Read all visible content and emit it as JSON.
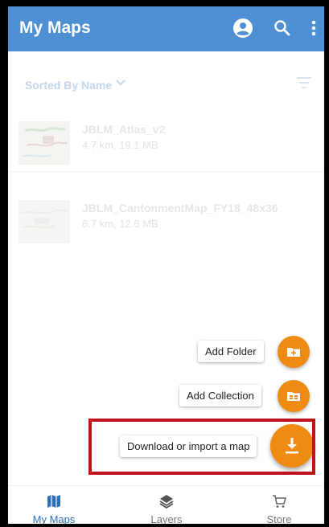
{
  "app_bar": {
    "title": "My Maps",
    "icons": [
      "account-icon",
      "search-icon",
      "more-vert-icon"
    ]
  },
  "sort": {
    "label": "Sorted By Name",
    "icon": "chevron-down-icon",
    "filter_icon": "filter-icon"
  },
  "maps": [
    {
      "name": "JBLM_Atlas_v2",
      "meta": "4.7 km, 19.1 MB"
    },
    {
      "name": "JBLM_CantonmentMap_FY18_48x36",
      "meta": "6.7 km, 12.6 MB"
    }
  ],
  "fab_menu": {
    "add_folder": "Add Folder",
    "add_collection": "Add Collection",
    "download_import": "Download or import a map"
  },
  "bottom_nav": [
    {
      "label": "My Maps",
      "icon": "map-icon"
    },
    {
      "label": "Layers",
      "icon": "layers-icon"
    },
    {
      "label": "Store",
      "icon": "cart-icon"
    }
  ],
  "colors": {
    "app_bar": "#4f8fd4",
    "accent_fab": "#ef8a12",
    "highlight": "#c0121a",
    "active_nav": "#2f6fb6"
  }
}
